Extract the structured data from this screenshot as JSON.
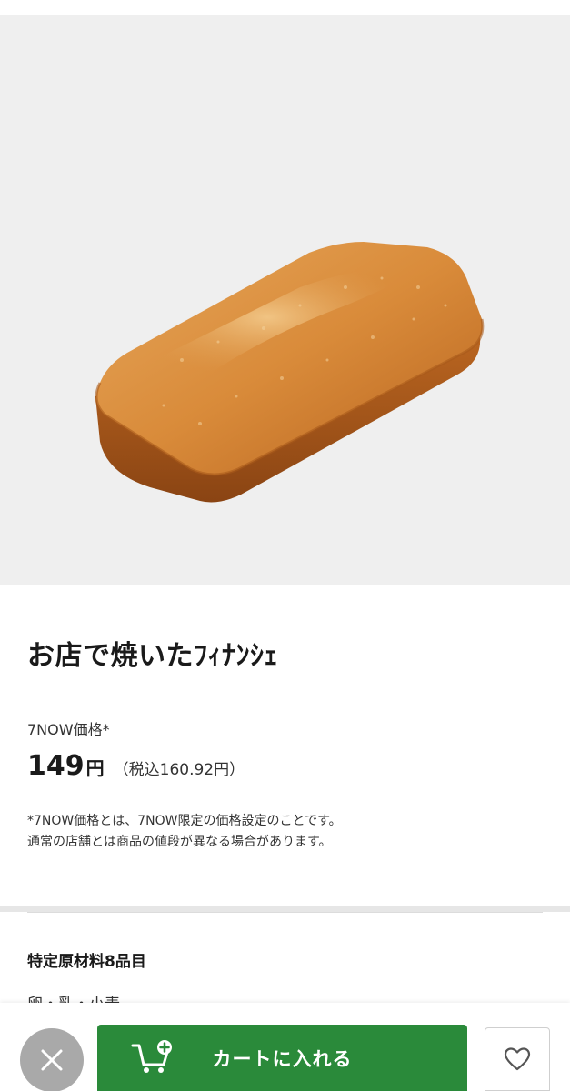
{
  "product": {
    "image_alt": "financier",
    "title": "お店で焼いたﾌｨﾅﾝｼｪ"
  },
  "pricing": {
    "label": "7NOW価格*",
    "price": "149",
    "yen": "円",
    "tax_included": "（税込160.92円）",
    "note_line1": "*7NOW価格とは、7NOW限定の価格設定のことです。",
    "note_line2": "通常の店舗とは商品の値段が異なる場合があります。"
  },
  "allergens": {
    "heading": "特定原材料8品目",
    "items": "卵・乳・小麦"
  },
  "actions": {
    "close_icon": "close-icon",
    "cart_label": "カートに入れる",
    "cart_icon": "cart-plus-icon",
    "favorite_icon": "heart-icon"
  },
  "colors": {
    "accent_green": "#2a8a3a",
    "close_gray": "#a9a9a9",
    "hero_bg": "#efefef"
  }
}
